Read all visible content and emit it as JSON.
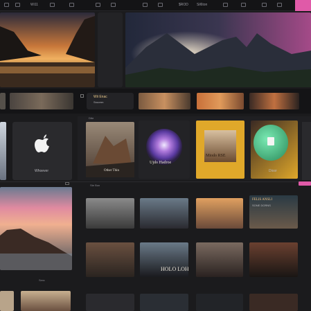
{
  "topbar": {
    "menu_label": "Wi11",
    "center_label": "$ROD",
    "right_label": "Sil6ton"
  },
  "cards": {
    "apple_label": "Whoever",
    "mountain_label": "Other Thin",
    "orb_label": "Ujdo Hadroe",
    "yellow_label": "Miodo RSE",
    "green_label": "Dioor",
    "mid_title": "Wii Enac",
    "mid_sub": "Sroorrm",
    "poster_title": "FELIS ANSLI",
    "poster_sub": "SONE DORNS",
    "film_caption": "HOLO LOHE",
    "section_label": "Dtte",
    "row_tab": "Ste Bon",
    "bottom_label": "Sera"
  },
  "colors": {
    "accent": "#e05aa8",
    "background": "#1b1b1d"
  }
}
